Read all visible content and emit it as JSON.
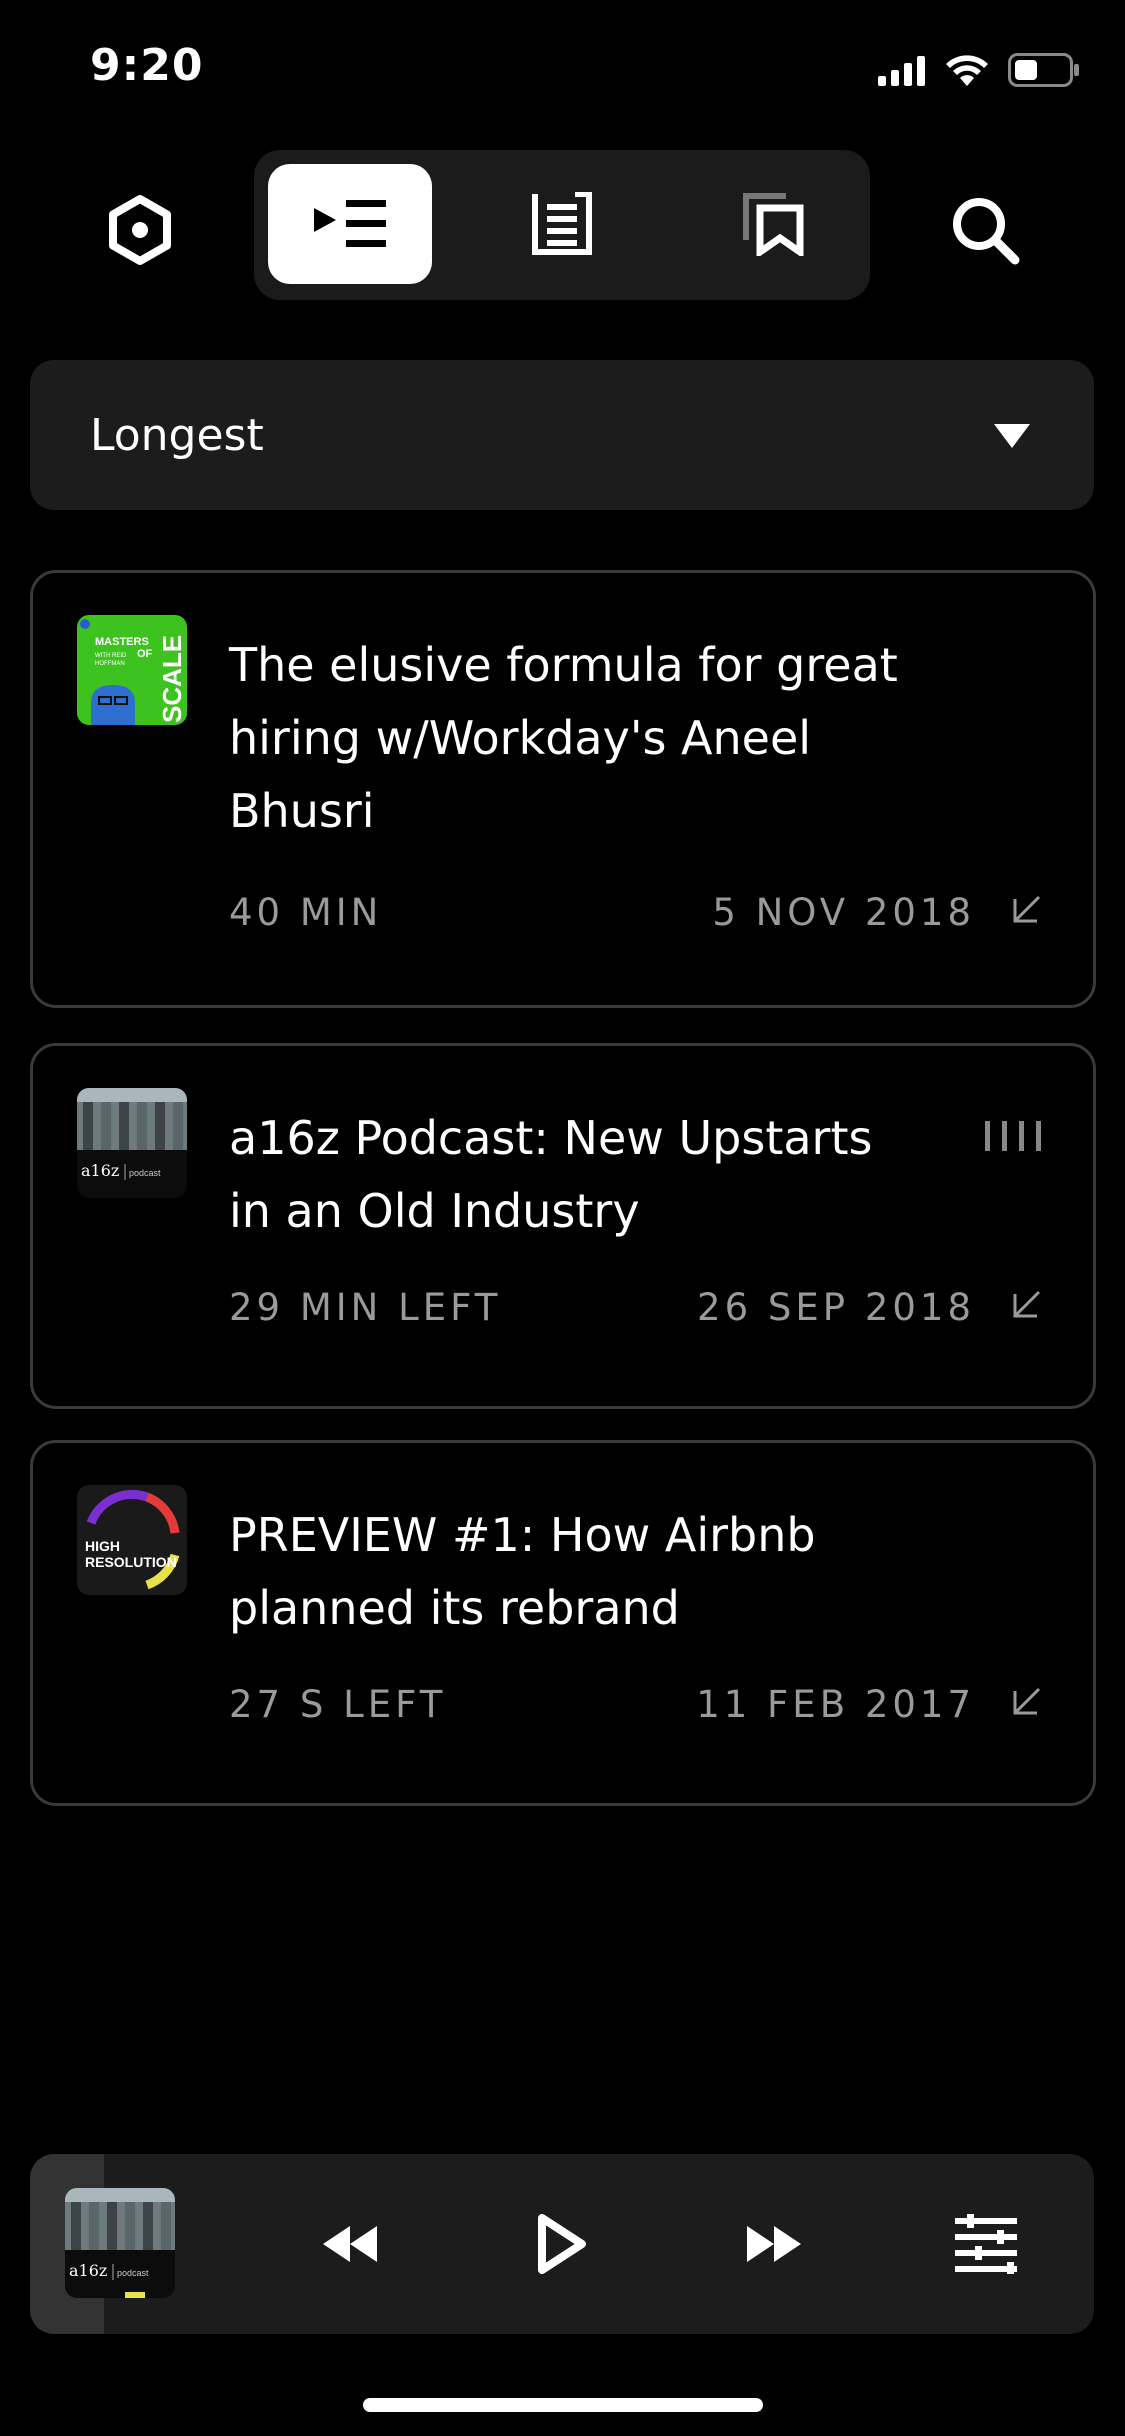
{
  "status": {
    "time": "9:20"
  },
  "nav": {
    "tabs": [
      "queue",
      "list",
      "bookmarks"
    ],
    "active_tab": "queue"
  },
  "sort": {
    "label": "Longest"
  },
  "episodes": [
    {
      "podcast_icon": "masters-of-scale-artwork",
      "artwork_text": {
        "title1": "MASTERS",
        "title2": "OF",
        "title3": "SCALE",
        "host1": "WITH REID",
        "host2": "HOFFMAN"
      },
      "title": "The elusive formula for great hiring w/Workday's Aneel Bhusri",
      "duration": "40 MIN",
      "date": "5 NOV 2018"
    },
    {
      "podcast_icon": "a16z-podcast-artwork",
      "artwork_text": {
        "brand": "a16z",
        "sub": "podcast"
      },
      "title": "a16z Podcast: New Upstarts in an Old Industry",
      "duration": "29 MIN LEFT",
      "date": "26 SEP 2018"
    },
    {
      "podcast_icon": "high-resolution-artwork",
      "artwork_text": {
        "line1": "HIGH",
        "line2": "RESOLUTION"
      },
      "title": "PREVIEW #1: How Airbnb planned its rebrand",
      "duration": "27 S LEFT",
      "date": "11 FEB 2017"
    }
  ],
  "player": {
    "artwork": "a16z-podcast-artwork",
    "artwork_text": {
      "brand": "a16z",
      "sub": "podcast"
    },
    "progress": 0.07
  },
  "colors": {
    "background": "#000000",
    "card_border": "#3a3a3a",
    "muted_text": "#9a9a9a",
    "panel": "#1c1c1c"
  }
}
